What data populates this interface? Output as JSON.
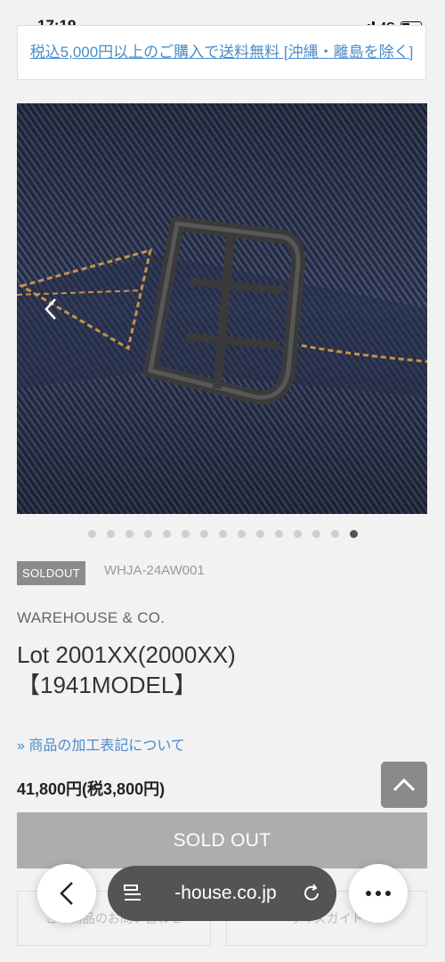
{
  "status_bar": {
    "time": "17:19",
    "network": "4G"
  },
  "promo_banner": {
    "text": "税込5,000円以上のご購入で送料無料 [沖縄・離島を除く]"
  },
  "gallery": {
    "slide_count": 15,
    "active_index": 14
  },
  "product": {
    "badge": "SOLDOUT",
    "sku": "WHJA-24AW001",
    "brand": "WAREHOUSE & CO.",
    "title_line1": "Lot 2001XX(2000XX)",
    "title_line2": "【1941MODEL】",
    "processing_link": "» 商品の加工表記について",
    "price": "41,800円(税3,800円)",
    "soldout_button": "SOLD OUT",
    "sub_button_left": "この商品のお問い合わせ",
    "sub_button_right": "サイズガイド"
  },
  "browser": {
    "url": "-house.co.jp"
  },
  "icons": {
    "prev": "chevron-left-icon",
    "scroll_top": "chevron-up-icon",
    "back": "back-arrow-icon",
    "tabs": "tab-list-icon",
    "reload": "reload-icon",
    "more": "more-dots-icon"
  },
  "colors": {
    "link": "#4a8cc9",
    "badge_bg": "#8c8c8c",
    "soldout_bg": "#adadad",
    "denim": "#2b3349",
    "stitch": "#c8914a"
  }
}
